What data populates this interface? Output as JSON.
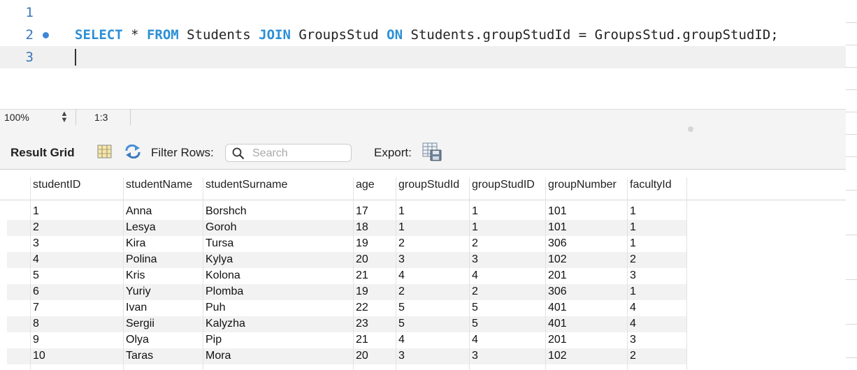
{
  "editor": {
    "lines": [
      {
        "number": "1"
      },
      {
        "number": "2",
        "tokens": [
          "SELECT",
          " * ",
          "FROM",
          " Students ",
          "JOIN",
          " GroupsStud ",
          "ON",
          " Students.groupStudId = GroupsStud.groupStudID;"
        ]
      },
      {
        "number": "3"
      }
    ]
  },
  "statusbar": {
    "zoom": "100%",
    "cursor_position": "1:3"
  },
  "toolbar": {
    "result_grid_label": "Result Grid",
    "filter_rows_label": "Filter Rows:",
    "search_placeholder": "Search",
    "export_label": "Export:",
    "icons": [
      "grid-view-icon",
      "refresh-icon",
      "search-icon",
      "export-icon"
    ]
  },
  "grid": {
    "columns": [
      "studentID",
      "studentName",
      "studentSurname",
      "age",
      "groupStudId",
      "groupStudID",
      "groupNumber",
      "facultyId"
    ],
    "rows": [
      [
        "1",
        "Anna",
        "Borshch",
        "17",
        "1",
        "1",
        "101",
        "1"
      ],
      [
        "2",
        "Lesya",
        "Goroh",
        "18",
        "1",
        "1",
        "101",
        "1"
      ],
      [
        "3",
        "Kira",
        "Tursa",
        "19",
        "2",
        "2",
        "306",
        "1"
      ],
      [
        "4",
        "Polina",
        "Kylya",
        "20",
        "3",
        "3",
        "102",
        "2"
      ],
      [
        "5",
        "Kris",
        "Kolona",
        "21",
        "4",
        "4",
        "201",
        "3"
      ],
      [
        "6",
        "Yuriy",
        "Plomba",
        "19",
        "2",
        "2",
        "306",
        "1"
      ],
      [
        "7",
        "Ivan",
        "Puh",
        "22",
        "5",
        "5",
        "401",
        "4"
      ],
      [
        "8",
        "Sergii",
        "Kalyzha",
        "23",
        "5",
        "5",
        "401",
        "4"
      ],
      [
        "9",
        "Olya",
        "Pip",
        "21",
        "4",
        "4",
        "201",
        "3"
      ],
      [
        "10",
        "Taras",
        "Mora",
        "20",
        "3",
        "3",
        "102",
        "2"
      ]
    ]
  },
  "colors": {
    "keyword": "#2b8fd6",
    "line_number": "#3a76b8",
    "breakpoint_dot": "#3f86d8",
    "current_line": "#f0f0f0",
    "row_alt": "#f2f2f2"
  }
}
